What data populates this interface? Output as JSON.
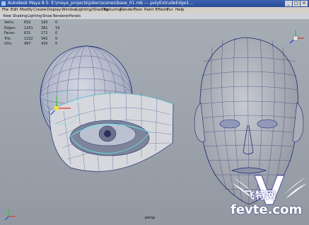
{
  "window": {
    "title": "Autodesk Maya 8.5: E:\\maya_projects\\joker\\scenes\\base_01.mb   ---   polyExtrudeEdge1..."
  },
  "menubar": {
    "items": [
      "File",
      "Edit",
      "Modify",
      "Create",
      "Display",
      "Window",
      "Lighting/Shading",
      "Texturing",
      "Render",
      "Toon",
      "Paint Effects",
      "Fur",
      "Help"
    ]
  },
  "panel_menu": {
    "items": [
      "View",
      "Shading",
      "Lighting",
      "Show",
      "Renderer",
      "Panels"
    ]
  },
  "hud": {
    "rows": [
      {
        "label": "Verts:",
        "v1": "632",
        "v2": "190",
        "v3": "0"
      },
      {
        "label": "Edges:",
        "v1": "1261",
        "v2": "381",
        "v3": "19"
      },
      {
        "label": "Faces:",
        "v1": "631",
        "v2": "171",
        "v3": "0"
      },
      {
        "label": "Tris:",
        "v1": "1222",
        "v2": "342",
        "v3": "0"
      },
      {
        "label": "UVs:",
        "v1": "997",
        "v2": "430",
        "v3": "0"
      }
    ]
  },
  "camera_label": "persp",
  "watermark": {
    "logo_letter": "V",
    "chinese": "飞特网",
    "url": "fevte.com"
  },
  "colors": {
    "titlebar": "#2a4d99",
    "menubar": "#d4d0c8",
    "viewport": "#9aa1a9",
    "wire": "#1c2a6e",
    "selected_wire": "#5fe3e6",
    "hud_text": "#0b1a0b"
  },
  "icons": {
    "window_minimize": "minimize-icon",
    "window_maximize": "maximize-icon",
    "window_close": "close-icon",
    "view_cube": "view-axis-icon",
    "axis_gizmo": "axis-gizmo-icon"
  }
}
